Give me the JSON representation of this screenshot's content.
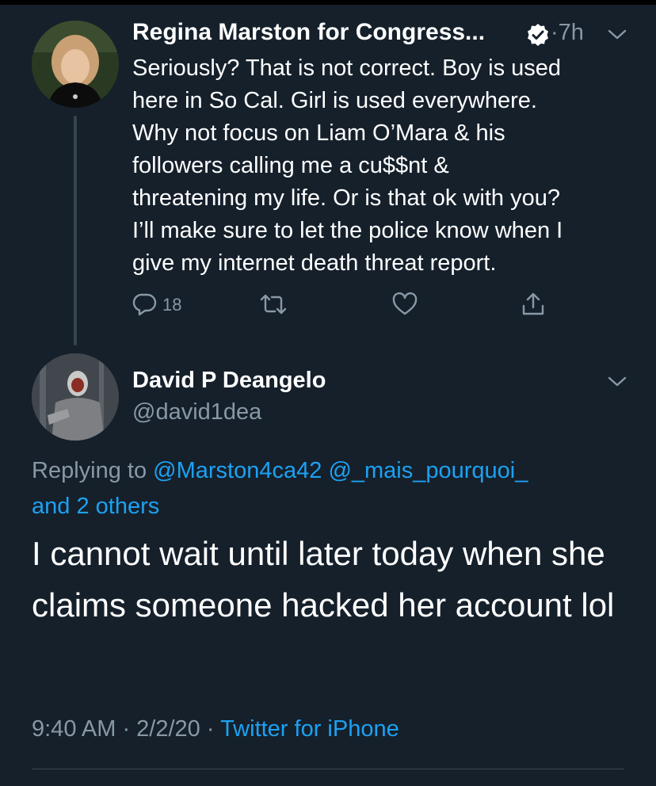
{
  "tweet1": {
    "author_name": "Regina Marston for Congress...",
    "time": "7h",
    "separator": "·",
    "text": "Seriously? That is not correct. Boy is used\nhere in So Cal. Girl is used everywhere.\nWhy not focus on Liam O’Mara & his\nfollowers calling me a cu$$nt &\nthreatening my life. Or is that ok with you?\nI’ll make sure to let the police know when I\ngive my internet death threat report.",
    "reply_count": "18"
  },
  "tweet2": {
    "author_name": "David P Deangelo",
    "handle": "@david1dea",
    "replying_prefix": "Replying to",
    "mention1": "@Marston4ca42",
    "mention2": "@_mais_pourquoi_",
    "others": "and 2 others",
    "text": "I cannot wait until later today when she claims someone hacked her account lol",
    "timestamp": "9:40 AM · 2/2/20",
    "separator": " · ",
    "source": "Twitter for iPhone"
  },
  "icons": {
    "verified": "verified-badge-icon",
    "chevron": "chevron-down-icon",
    "reply": "reply-icon",
    "retweet": "retweet-icon",
    "like": "heart-icon",
    "share": "share-icon"
  },
  "colors": {
    "background": "#15202b",
    "secondary_text": "#8899a6",
    "link": "#1da1f2",
    "divider": "#38444d"
  }
}
